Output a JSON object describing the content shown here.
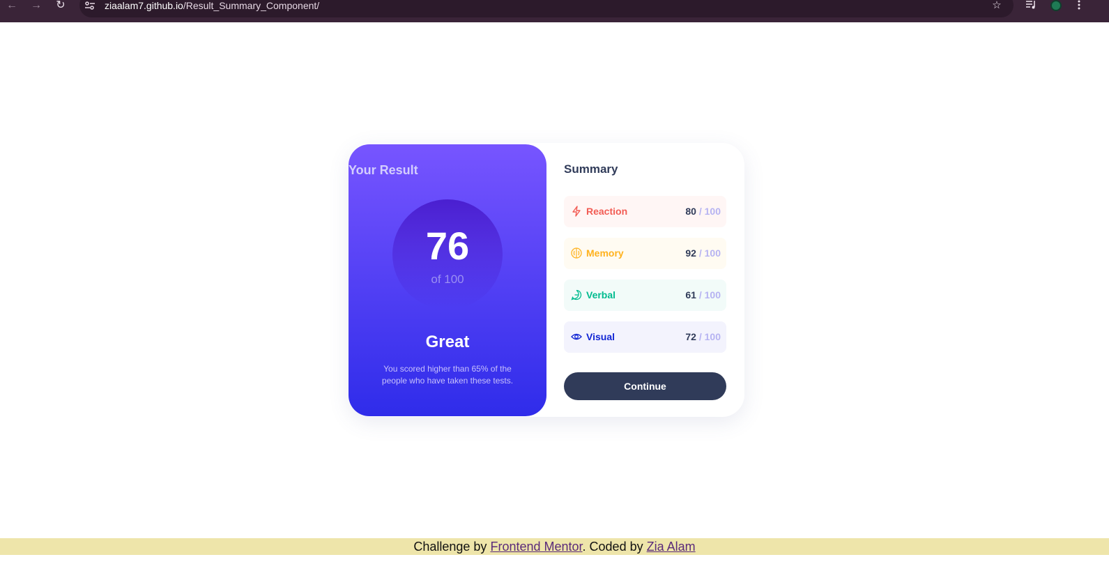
{
  "browser": {
    "back_icon": "←",
    "forward_icon": "→",
    "reload_icon": "↻",
    "url_host": "ziaalam7.github.io",
    "url_path": "/Result_Summary_Component/",
    "star_icon": "☆"
  },
  "result": {
    "heading": "Your Result",
    "score": "76",
    "score_of": "of 100",
    "rating": "Great",
    "description": "You scored higher than 65% of the people who have taken these tests."
  },
  "summary": {
    "title": "Summary",
    "items": [
      {
        "label": "Reaction",
        "score": "80",
        "max": "/ 100",
        "color": "#f25c54",
        "bg": "#fff6f5",
        "icon": "lightning-icon"
      },
      {
        "label": "Memory",
        "score": "92",
        "max": "/ 100",
        "color": "#ffb21e",
        "bg": "#fffbf2",
        "icon": "brain-icon"
      },
      {
        "label": "Verbal",
        "score": "61",
        "max": "/ 100",
        "color": "#00bb8f",
        "bg": "#f2fbf9",
        "icon": "chat-icon"
      },
      {
        "label": "Visual",
        "score": "72",
        "max": "/ 100",
        "color": "#1125d4",
        "bg": "#f3f3fd",
        "icon": "eye-icon"
      }
    ],
    "button": "Continue"
  },
  "footer": {
    "prefix": "Challenge by",
    "link1": "Frontend Mentor",
    "middle": ". Coded by",
    "link2": "Zia Alam"
  }
}
